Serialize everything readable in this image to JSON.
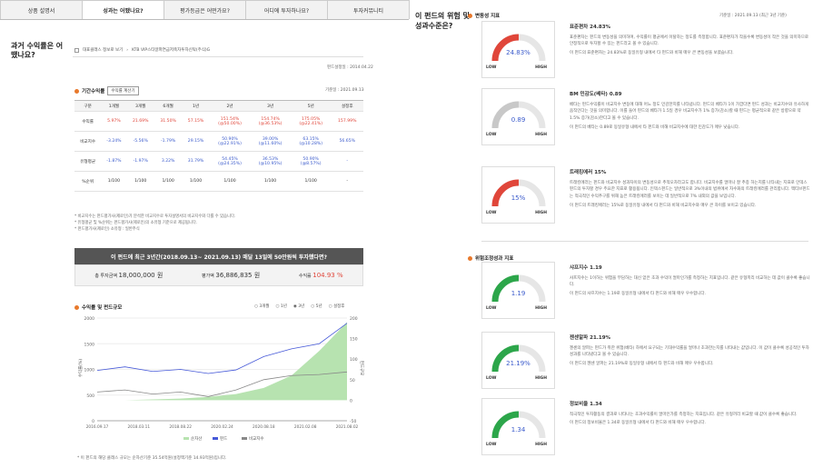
{
  "tabs": [
    "상품 설명서",
    "성과는 어땠나요?",
    "평가등급은 어떤가요?",
    "어디에 투자하나요?",
    "투자커뮤니티"
  ],
  "left": {
    "heading": "과거 수익률은 어땠나요?",
    "class_checkbox": "대표클래스 정보로 보기",
    "class_name": "KTB VIP스타알파연금저축자투자신탁(주식)G",
    "setup_date": "펀드설정일 : 2014.04.22",
    "period_title": "기간수익률",
    "calc_button": "수익률 계산기",
    "base_date": "기준일 : 2021.09.13",
    "cols": [
      "구분",
      "1개월",
      "3개월",
      "6개월",
      "1년",
      "2년",
      "3년",
      "5년",
      "설정후"
    ],
    "rows": [
      {
        "label": "수익률",
        "cells": [
          "5.97%",
          "21.69%",
          "31.50%",
          "57.15%",
          "151.54%\n(@50.00%)",
          "154.74%\n(@36.53%)",
          "175.05%\n(@22.41%)",
          "157.99%"
        ],
        "tone": "red"
      },
      {
        "label": "비교지수",
        "cells": [
          "-3.24%",
          "-5.56%",
          "-1.79%",
          "29.15%",
          "50.90%\n(@22.91%)",
          "39.00%\n(@11.60%)",
          "63.15%\n(@10.28%)",
          "56.65%"
        ],
        "tone": "blue"
      },
      {
        "label": "유형평균",
        "cells": [
          "-1.87%",
          "-1.97%",
          "3.22%",
          "31.79%",
          "54.45%\n(@24.35%)",
          "36.53%\n(@10.95%)",
          "50.90%\n(@8.57%)",
          "-"
        ],
        "tone": "blue"
      },
      {
        "label": "%순위",
        "cells": [
          "1/100",
          "1/100",
          "1/100",
          "1/100",
          "1/100",
          "1/100",
          "1/100",
          "-"
        ],
        "tone": ""
      }
    ],
    "notes": [
      "* 비교지수는 펀드평가사(제로인)가 분석한 비교지수로 투자설명서의 비교지수와 다를 수 있습니다.",
      "* 유형평균 및 %순위는 펀드평가사(제로인)의 소유형 기준으로 제공됩니다.",
      "* 펀드평가사(제로인) 소유형 : 일반주식"
    ],
    "sim_title": "이 펀드에 최근 3년간(2018.09.13~ 2021.09.13) 매달 13일에 50만원씩 투자했다면?",
    "sim_paid_label": "총 투자금액",
    "sim_paid": "18,000,000 원",
    "sim_eval_label": "평가액",
    "sim_eval": "36,886,835 원",
    "sim_rate_label": "수익률",
    "sim_rate": "104.93 %",
    "chart_title": "수익률 및 펀드규모",
    "radios": [
      "3개월",
      "1년",
      "3년",
      "5년",
      "설정후"
    ],
    "note2": "* 이 펀드의 해당 클래스 규모는 순자산기준 35.54억원(설정액기준 14.93억원)입니다."
  },
  "right": {
    "heading": "이 펀드의 위험 및 성과수준은?",
    "vol_title": "변동성 지표",
    "base": "기준일 : 2021.09.13 (최근 3년 기준)",
    "risk_title": "위험조정성과 지표",
    "low": "LOW",
    "high": "HIGH",
    "metrics": [
      {
        "value": "24.83%",
        "title": "표준편차 24.83%",
        "desc": "표준편차는 펀드의 변동성을 의미하며, 수익률이 평균에서 이탈하는 정도를 측정합니다. 표준편차가 작을수록 변동성이 작은 것을 의미하므로 안정적으로 투자할 수 있는 펀드라고 볼 수 있습니다.",
        "desc2": "이 펀드의 표준편차는 24.83%로 동일유형 내에서 타 펀드와 비해 매우 큰 변동성을 보였습니다.",
        "color": "#e0463a",
        "level": 0.5
      },
      {
        "value": "0.89",
        "title": "BM 민감도(베타) 0.89",
        "desc": "베타는 펀드수익률이 비교지수 변동에 대해 어느 정도 민감한지를 나타냅니다. 펀드의 베타가 1이 가깝다면 펀드 성과는 비교지수와 유사하게 움직인다는 것을 의미합니다. 이를 들어 펀드의 베타가 1.5일 경우 비교지수가 1% 증가(감소)할 때 펀드는 평균적으로 같은 방향으로 약 1.5% 증가(감소)한다고 볼 수 있습니다.",
        "desc2": "이 펀드의 베타는 0.89로 동일유형 내에서 타 펀드와 비해 비교지수에 대한 민감도가 매우 낮습니다.",
        "color": "#c8c8c8",
        "level": 0.5
      },
      {
        "value": "15%",
        "title": "트래킹에러 15%",
        "desc": "트래킹에러는 펀드와 비교지수 성과차이의 변동성으로 추적오차라고도 합니다. 비교지수를 얼마나 잘 추종 하는지를 나타내는 지표로 인덱스펀드의 투자할 경우 주요한 지표로 활용됩니다. 인덱스펀드는 일반적으로 3%이내의 범위에서 자수화의 트래킹에러를 관리합니다. 액티브펀드는 적극적인 수익추구를 위해 높은 트래킹에러를 보이는 데 일반적으로 7% 내외의 값을 보입니다.",
        "desc2": "이 펀드의 트래킹에러는 15%로 동일유형 내에서 타 펀드와 비해 비교지수와 매우 큰 차이를 보이고 있습니다.",
        "color": "#e0463a",
        "level": 0.5
      },
      {
        "value": "1.19",
        "title": "샤프지수 1.19",
        "desc": "샤프지수는 1이하는 위험을 부담하는 대신 얻은 초과 수익이 얼마인가를 측정하는 지표입니다. 같은 유형끼리 비교하는 데 값이 클수록 좋습니다.",
        "desc2": "이 펀드의 샤프지수는 1.19로 동일유형 내에서 타 펀드와 비해 매우 우수합니다.",
        "color": "#2ca64a",
        "level": 0.5
      },
      {
        "value": "21.19%",
        "title": "젠센알파 21.19%",
        "desc": "젠센의 알파는 펀드가 취한 위험(베타) 하에서 요구되는 기대수익률을 얼마나 초과한는지를 나타내는 값입니다. 이 값이 클수록 성공적인 투자성과를 나타냈다고 볼 수 있습니다.",
        "desc2": "이 펀드의 젠센 알파는 21.19%로 동일유형 내에서 타 펀드와 비해 매우 우수합니다.",
        "color": "#2ca64a",
        "level": 0.5
      },
      {
        "value": "1.34",
        "title": "정보비율 1.34",
        "desc": "적극적인 투자활동의 결과로 나타나는 초과수익률이 얼마인가를 측정하는 지표입니다. 같은 유형끼리 비교할 때 값이 클수록 좋습니다.",
        "desc2": "이 펀드의 정보비율은 1.34로 동일유형 내에서 타 펀드와 비해 매우 우수합니다.",
        "color": "#2ca64a",
        "level": 0.5
      }
    ]
  },
  "chart_data": {
    "type": "line",
    "x": [
      "2016.09.17",
      "2018.03.11",
      "2018.08.22",
      "2020.02.24",
      "2020.08.18",
      "2021.02.08",
      "2021.08.02"
    ],
    "ylim_left": [
      0,
      2000
    ],
    "yticks_left": [
      0,
      500,
      1000,
      1500,
      2000
    ],
    "ylim_right": [
      -50,
      200
    ],
    "yticks_right": [
      -50,
      0,
      50,
      100,
      150,
      200
    ],
    "ylabel_left": "수익률(%)",
    "ylabel_right": "펀드규모",
    "series": [
      {
        "name": "순자산",
        "values": [
          0,
          0,
          2,
          4,
          8,
          15,
          30,
          60,
          120,
          190
        ]
      },
      {
        "name": "펀드",
        "values": [
          980,
          1050,
          960,
          1000,
          920,
          990,
          1250,
          1400,
          1500,
          1900
        ]
      },
      {
        "name": "비교지수",
        "values": [
          560,
          600,
          520,
          560,
          470,
          600,
          800,
          880,
          900,
          950
        ]
      }
    ],
    "legend": [
      "순자산",
      "펀드",
      "비교지수"
    ]
  }
}
